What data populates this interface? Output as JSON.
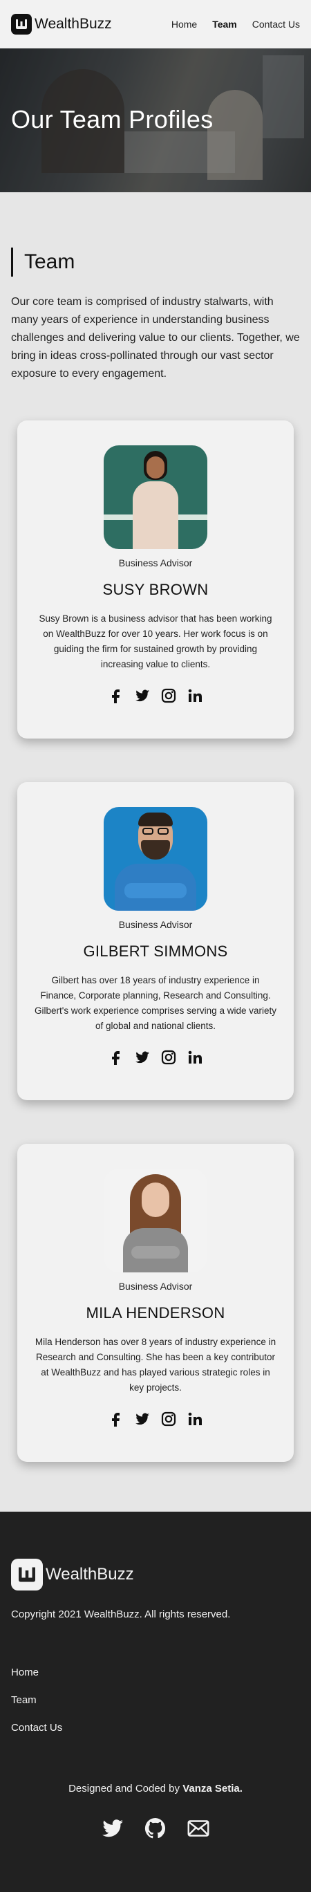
{
  "brand": {
    "name": "WealthBuzz"
  },
  "nav": {
    "items": [
      "Home",
      "Team",
      "Contact Us"
    ],
    "active": "Team"
  },
  "hero": {
    "title": "Our Team Profiles"
  },
  "team_section": {
    "title": "Team",
    "intro": "Our core team is comprised of industry stalwarts, with many years of experience in understanding business challenges and delivering value to our clients. Together, we bring in ideas cross-pollinated through our vast sector exposure to every engagement."
  },
  "members": [
    {
      "role": "Business Advisor",
      "name": "SUSY BROWN",
      "bio": "Susy Brown is a business advisor that has been working on WealthBuzz for over 10 years. Her work focus is on guiding the firm for sustained growth by providing increasing value to clients.",
      "photo_bg": "#2e6e62"
    },
    {
      "role": "Business Advisor",
      "name": "GILBERT SIMMONS",
      "bio": "Gilbert has over 18 years of industry experience in Finance, Corporate planning, Research and Consulting. Gilbert's work experience comprises serving a wide variety of global and national clients.",
      "photo_bg": "#1c84c6"
    },
    {
      "role": "Business Advisor",
      "name": "MILA HENDERSON",
      "bio": "Mila Henderson has over 8 years of industry experience in Research and Consulting. She has been a key contributor at WealthBuzz and has played various strategic roles in key projects.",
      "photo_bg": "#f3f3f3"
    }
  ],
  "member_socials": [
    "facebook-icon",
    "twitter-icon",
    "instagram-icon",
    "linkedin-icon"
  ],
  "footer": {
    "brand": "WealthBuzz",
    "copyright": "Copyright 2021 WealthBuzz. All rights reserved.",
    "links": [
      "Home",
      "Team",
      "Contact Us"
    ],
    "credit_prefix": "Designed and Coded by",
    "credit_name": "Vanza Setia.",
    "icons": [
      "twitter-icon",
      "github-icon",
      "mail-icon"
    ]
  },
  "colors": {
    "background": "#e6e6e6",
    "card": "#f2f2f2",
    "footer": "#212121",
    "text": "#1f1f1f"
  }
}
